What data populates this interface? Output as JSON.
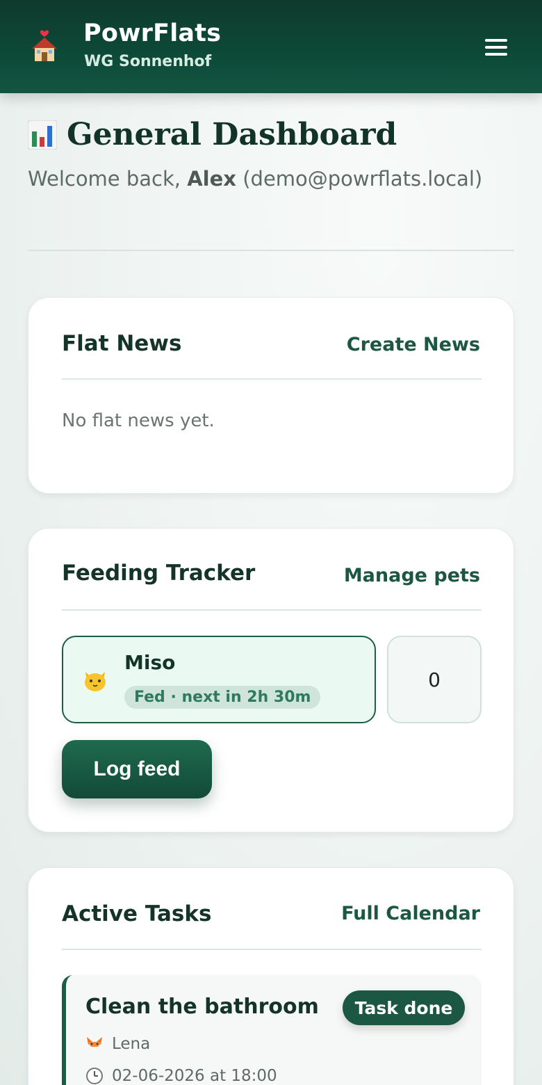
{
  "header": {
    "app_name": "PowrFlats",
    "flat_name": "WG Sonnenhof",
    "logo_icon": "house-with-heart-icon",
    "menu_icon": "hamburger-menu-icon"
  },
  "dashboard": {
    "title": "General Dashboard",
    "title_icon": "bar-chart-icon",
    "welcome_prefix": "Welcome back, ",
    "user_name": "Alex",
    "user_email": "(demo@powrflats.local)"
  },
  "flat_news": {
    "title": "Flat News",
    "action_label": "Create News",
    "empty_text": "No flat news yet."
  },
  "feeding_tracker": {
    "title": "Feeding Tracker",
    "action_label": "Manage pets",
    "pets": [
      {
        "name": "Miso",
        "icon": "cat-face-icon",
        "status": "Fed · next in 2h 30m"
      }
    ],
    "counter_value": "0",
    "log_button_label": "Log feed"
  },
  "active_tasks": {
    "title": "Active Tasks",
    "action_label": "Full Calendar",
    "tasks": [
      {
        "title": "Clean the bathroom",
        "assignee": "Lena",
        "assignee_icon": "fox-face-icon",
        "due": "02-06-2026 at 18:00",
        "due_icon": "clock-icon",
        "action_label": "Task done"
      }
    ]
  },
  "colors": {
    "brand_dark": "#0f3a2d",
    "brand": "#1b5742",
    "accent_light": "#eafaf3"
  }
}
